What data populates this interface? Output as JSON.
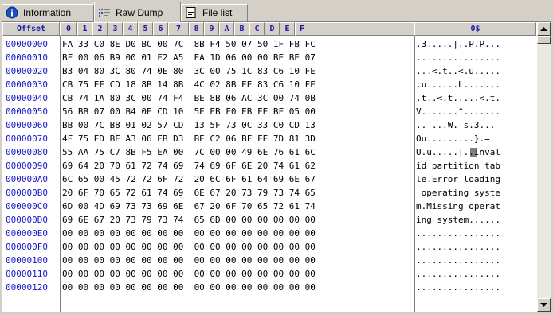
{
  "tabs": [
    {
      "label": "Information",
      "icon": "info-icon",
      "active": false
    },
    {
      "label": "Raw Dump",
      "icon": "raw-dump-icon",
      "active": true
    },
    {
      "label": "File list",
      "icon": "file-list-icon",
      "active": false
    }
  ],
  "columns": {
    "offset": "Offset",
    "bytes": [
      "0",
      "1",
      "2",
      "3",
      "4",
      "5",
      "6",
      "7",
      "8",
      "9",
      "A",
      "B",
      "C",
      "D",
      "E",
      "F"
    ],
    "ascii": "0$"
  },
  "rows": [
    {
      "offset": "00000000",
      "hex": "FA 33 C0 8E D0 BC 00 7C  8B F4 50 07 50 1F FB FC",
      "ascii": ".3.....|..P.P..."
    },
    {
      "offset": "00000010",
      "hex": "BF 00 06 B9 00 01 F2 A5  EA 1D 06 00 00 BE BE 07",
      "ascii": "................"
    },
    {
      "offset": "00000020",
      "hex": "B3 04 80 3C 80 74 0E 80  3C 00 75 1C 83 C6 10 FE",
      "ascii": "...<.t..<.u....."
    },
    {
      "offset": "00000030",
      "hex": "CB 75 EF CD 18 8B 14 8B  4C 02 8B EE 83 C6 10 FE",
      "ascii": ".u......L......."
    },
    {
      "offset": "00000040",
      "hex": "CB 74 1A 80 3C 00 74 F4  BE 8B 06 AC 3C 00 74 0B",
      "ascii": ".t..<.t.....<.t."
    },
    {
      "offset": "00000050",
      "hex": "56 BB 07 00 B4 0E CD 10  5E EB F0 EB FE BF 05 00",
      "ascii": "V.......^......."
    },
    {
      "offset": "00000060",
      "hex": "BB 00 7C B8 01 02 57 CD  13 5F 73 0C 33 C0 CD 13",
      "ascii": "..|...W._s.3..."
    },
    {
      "offset": "00000070",
      "hex": "4F 75 ED BE A3 06 EB D3  BE C2 06 BF FE 7D 81 3D",
      "ascii": "Ou.........}.="
    },
    {
      "offset": "00000080",
      "hex": "55 AA 75 C7 8B F5 EA 00  7C 00 00 49 6E 76 61 6C",
      "ascii": "U.u.....|..Inval"
    },
    {
      "offset": "00000090",
      "hex": "69 64 20 70 61 72 74 69  74 69 6F 6E 20 74 61 62",
      "ascii": "id partition tab"
    },
    {
      "offset": "000000A0",
      "hex": "6C 65 00 45 72 72 6F 72  20 6C 6F 61 64 69 6E 67",
      "ascii": "le.Error loading"
    },
    {
      "offset": "000000B0",
      "hex": "20 6F 70 65 72 61 74 69  6E 67 20 73 79 73 74 65",
      "ascii": " operating syste"
    },
    {
      "offset": "000000C0",
      "hex": "6D 00 4D 69 73 73 69 6E  67 20 6F 70 65 72 61 74",
      "ascii": "m.Missing operat"
    },
    {
      "offset": "000000D0",
      "hex": "69 6E 67 20 73 79 73 74  65 6D 00 00 00 00 00 00",
      "ascii": "ing system......"
    },
    {
      "offset": "000000E0",
      "hex": "00 00 00 00 00 00 00 00  00 00 00 00 00 00 00 00",
      "ascii": "................"
    },
    {
      "offset": "000000F0",
      "hex": "00 00 00 00 00 00 00 00  00 00 00 00 00 00 00 00",
      "ascii": "................"
    },
    {
      "offset": "00000100",
      "hex": "00 00 00 00 00 00 00 00  00 00 00 00 00 00 00 00",
      "ascii": "................"
    },
    {
      "offset": "00000110",
      "hex": "00 00 00 00 00 00 00 00  00 00 00 00 00 00 00 00",
      "ascii": "................"
    },
    {
      "offset": "00000120",
      "hex": "00 00 00 00 00 00 00 00  00 00 00 00 00 00 00 00",
      "ascii": "................"
    }
  ],
  "colors": {
    "offset_text": "#1515c8",
    "header_text": "#1a1aa8",
    "panel_bg": "#ffffff",
    "window_bg": "#d4d0c8"
  }
}
